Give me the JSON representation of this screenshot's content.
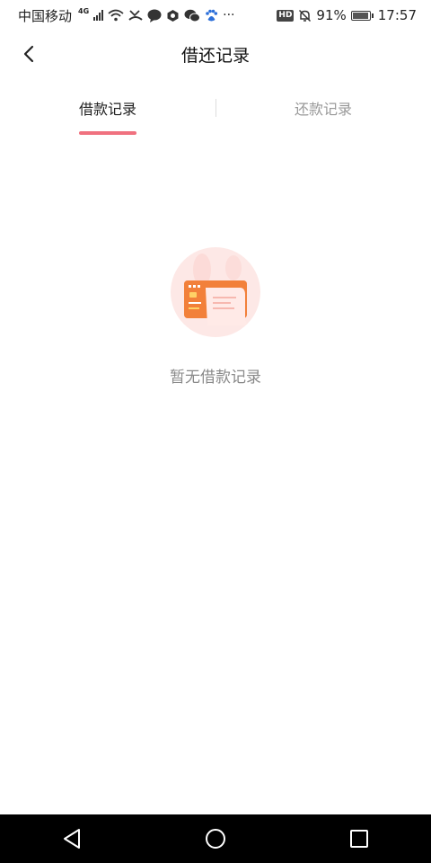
{
  "status_bar": {
    "carrier": "中国移动",
    "network_type": "4G",
    "overflow": "···",
    "hd_label": "HD",
    "battery_percent": "91%",
    "time": "17:57",
    "icons": [
      "signal-icon",
      "wifi-icon",
      "missed-call-icon",
      "chat-bubble-icon",
      "app-icon",
      "wechat-icon",
      "baidu-icon",
      "mute-bell-icon",
      "battery-icon"
    ]
  },
  "header": {
    "title": "借还记录",
    "back_icon": "chevron-left-icon"
  },
  "tabs": {
    "borrow_label": "借款记录",
    "repay_label": "还款记录",
    "active": "borrow",
    "active_color": "#f0717f"
  },
  "empty_state": {
    "illustration": "credit-card-receipt-illustration",
    "message": "暂无借款记录"
  },
  "nav_bar": {
    "back_icon": "triangle-back-icon",
    "home_icon": "circle-home-icon",
    "recents_icon": "square-recents-icon"
  }
}
